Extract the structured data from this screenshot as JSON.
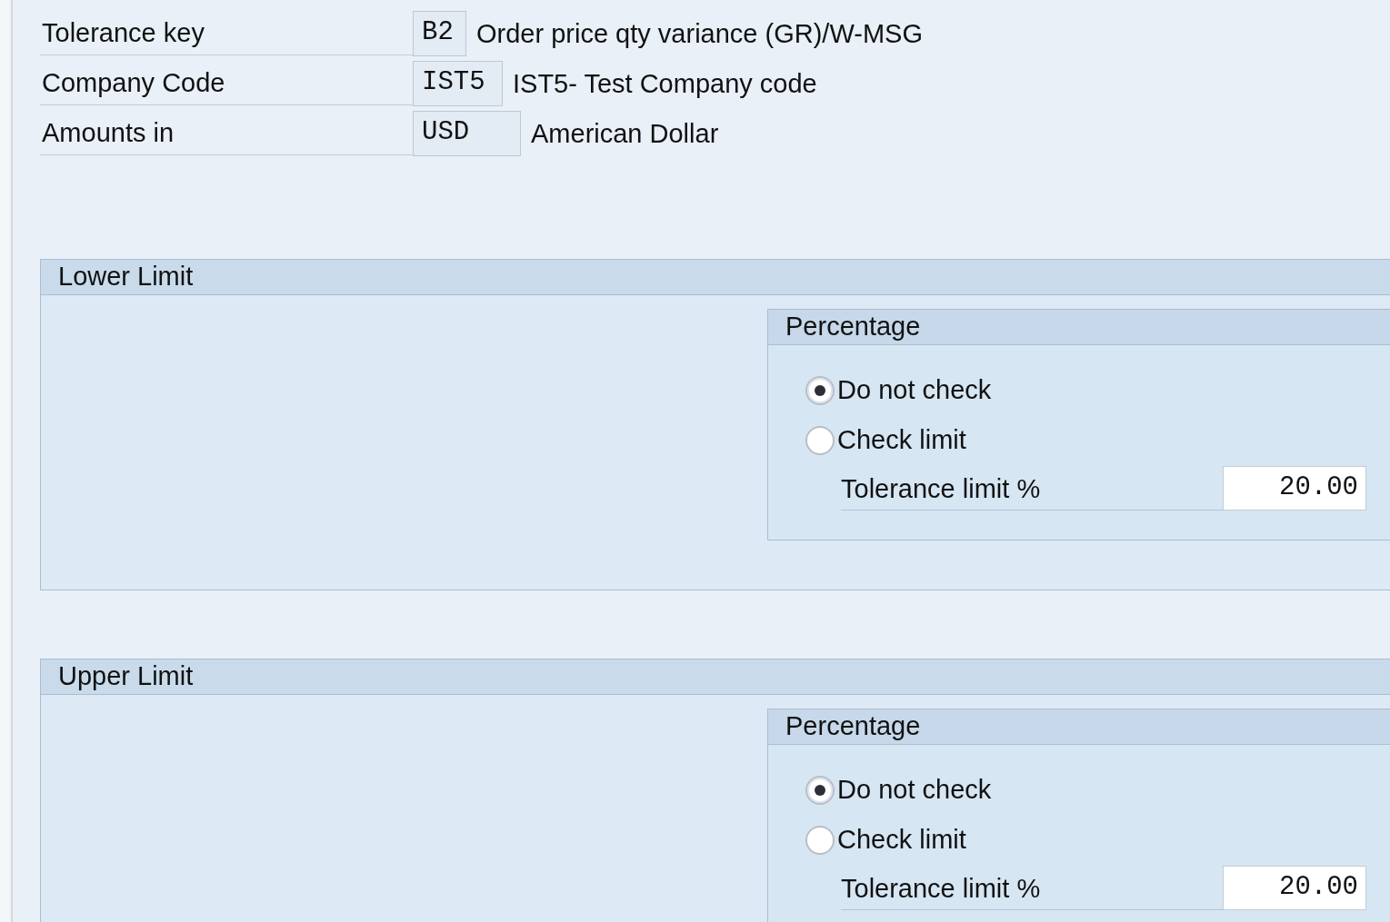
{
  "header_fields": [
    {
      "label": "Tolerance key",
      "value": "B2",
      "description": "Order price qty variance (GR)/W-MSG"
    },
    {
      "label": "Company Code",
      "value": "IST5",
      "description": "IST5- Test Company code"
    },
    {
      "label": "Amounts in",
      "value": "USD",
      "description": "American Dollar"
    }
  ],
  "groups": [
    {
      "title": "Lower Limit",
      "subgroup": {
        "title": "Percentage",
        "options": [
          {
            "label": "Do not check",
            "selected": true
          },
          {
            "label": "Check limit",
            "selected": false
          }
        ],
        "limit_label": "Tolerance limit %",
        "limit_value": "20.00"
      }
    },
    {
      "title": "Upper Limit",
      "subgroup": {
        "title": "Percentage",
        "options": [
          {
            "label": "Do not check",
            "selected": true
          },
          {
            "label": "Check limit",
            "selected": false
          }
        ],
        "limit_label": "Tolerance limit %",
        "limit_value": "20.00"
      }
    }
  ]
}
